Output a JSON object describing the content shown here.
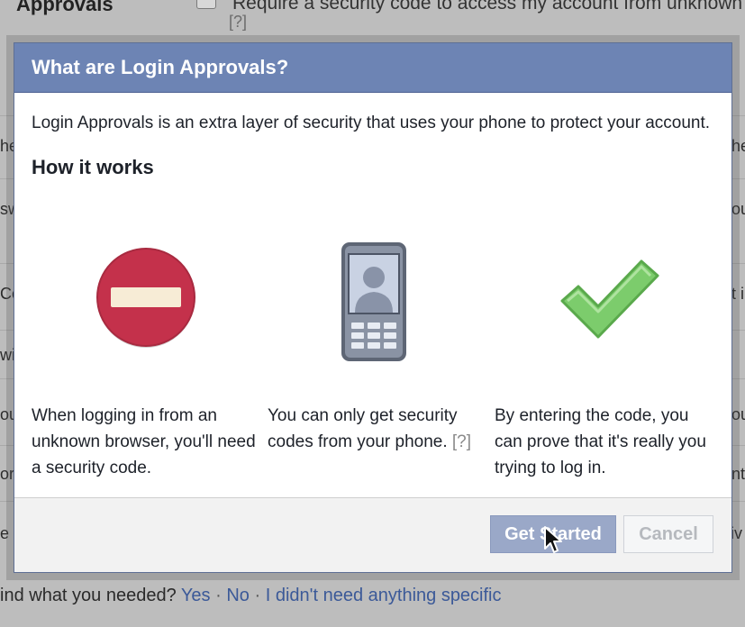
{
  "background": {
    "top_title": "Approvals",
    "top_checkbox_text": "Require a security code to access my account from unknown",
    "top_help": "[?]",
    "side_fragments_left": [
      "he",
      "sw",
      "Co",
      "wi",
      "ou",
      "or",
      "e"
    ],
    "side_fragments_right": [
      "he",
      "ou",
      "t i",
      "ou",
      "nt",
      "tiv"
    ],
    "feedback": {
      "prompt": "ind what you needed?",
      "yes": "Yes",
      "sep1": "·",
      "no": "No",
      "sep2": "·",
      "nothing_specific": "I didn't need anything specific"
    }
  },
  "dialog": {
    "title": "What are Login Approvals?",
    "intro": "Login Approvals is an extra layer of security that uses your phone to protect your account.",
    "how_title": "How it works",
    "steps": [
      {
        "text": "When logging in from an unknown browser, you'll need a security code.",
        "icon": "blocked-icon"
      },
      {
        "text": "You can only get security codes from your phone.",
        "help": "[?]",
        "icon": "phone-icon"
      },
      {
        "text": "By entering the code, you can prove that it's really you trying to log in.",
        "icon": "checkmark-icon"
      }
    ],
    "buttons": {
      "get_started": "Get Started",
      "cancel": "Cancel"
    }
  },
  "colors": {
    "header": "#6d84b4",
    "primary_button": "#9aa8c8",
    "blocked_red": "#c4314b",
    "check_green": "#7ccc6c",
    "link": "#3b5998"
  }
}
